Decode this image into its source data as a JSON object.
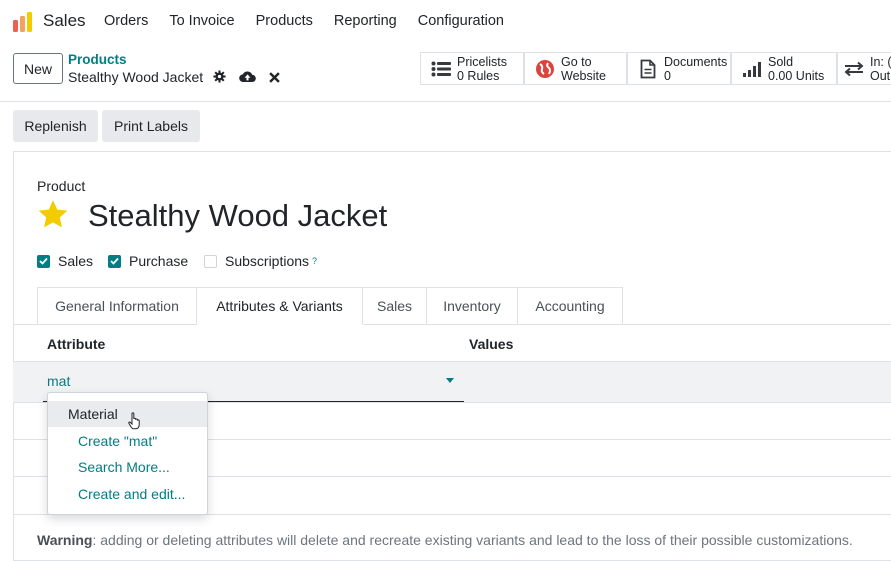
{
  "topnav": {
    "app_name": "Sales",
    "menu": [
      "Orders",
      "To Invoice",
      "Products",
      "Reporting",
      "Configuration"
    ]
  },
  "control": {
    "new_label": "New",
    "breadcrumb_parent": "Products",
    "breadcrumb_current": "Stealthy Wood Jacket"
  },
  "smart_buttons": [
    {
      "icon": "list-icon",
      "line1": "Pricelists",
      "line2": "0 Rules"
    },
    {
      "icon": "globe-icon",
      "line1": "Go to",
      "line2": "Website"
    },
    {
      "icon": "document-icon",
      "line1": "Documents",
      "line2": "0"
    },
    {
      "icon": "bar-chart-icon",
      "line1": "Sold",
      "line2": "0.00 Units"
    },
    {
      "icon": "transfer-icon",
      "line1": "In: (",
      "line2": "Out:"
    }
  ],
  "actions": {
    "replenish": "Replenish",
    "print_labels": "Print Labels"
  },
  "form": {
    "product_label": "Product",
    "product_name": "Stealthy Wood Jacket",
    "checkboxes": [
      {
        "label": "Sales",
        "checked": true
      },
      {
        "label": "Purchase",
        "checked": true
      },
      {
        "label": "Subscriptions",
        "checked": false,
        "help": "?"
      }
    ]
  },
  "tabs": [
    "General Information",
    "Attributes & Variants",
    "Sales",
    "Inventory",
    "Accounting"
  ],
  "active_tab": "Attributes & Variants",
  "table": {
    "col_attribute": "Attribute",
    "col_values": "Values",
    "input_value": "mat"
  },
  "dropdown": {
    "items": [
      "Material",
      "Create \"mat\"",
      "Search More...",
      "Create and edit..."
    ]
  },
  "warning": {
    "label": "Warning",
    "text": ": adding or deleting attributes will delete and recreate existing variants and lead to the loss of their possible customizations."
  },
  "colors": {
    "accent": "#017e84",
    "star": "#f3cc00"
  }
}
